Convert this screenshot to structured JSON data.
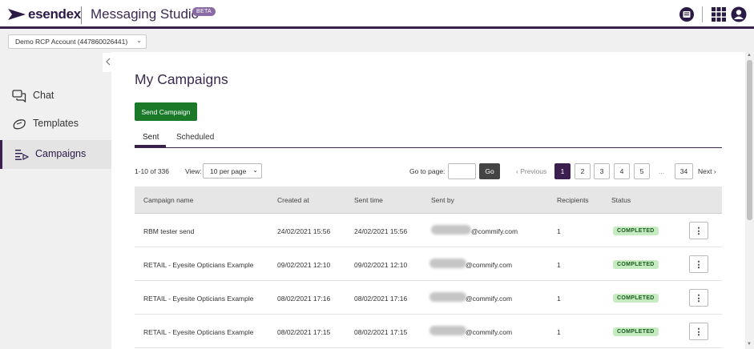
{
  "header": {
    "logo_text": "esendex",
    "app_title": "Messaging Studio",
    "beta_label": "BETA",
    "icons": [
      "contact-card-icon",
      "grid-apps-icon",
      "user-account-icon"
    ]
  },
  "account": {
    "selected": "Demo RCP Account (447860026441)"
  },
  "sidebar": {
    "items": [
      {
        "label": "Chat",
        "icon": "chat-bubbles-icon"
      },
      {
        "label": "Templates",
        "icon": "templates-icon"
      },
      {
        "label": "Campaigns",
        "icon": "campaigns-list-icon",
        "active": true
      }
    ]
  },
  "main": {
    "title": "My Campaigns",
    "send_button": "Send Campaign",
    "tabs": [
      {
        "label": "Sent",
        "active": true
      },
      {
        "label": "Scheduled"
      }
    ],
    "pagination": {
      "range_text": "1-10 of 336",
      "view_label": "View:",
      "view_selected": "10 per page",
      "goto_label": "Go to page:",
      "go_button": "Go",
      "previous": "Previous",
      "pages": [
        "1",
        "2",
        "3",
        "4",
        "5"
      ],
      "ellipsis": "...",
      "last_page": "34",
      "next": "Next",
      "current_page": "1"
    },
    "table": {
      "headers": [
        "Campaign name",
        "Created at",
        "Sent time",
        "Sent by",
        "Recipients",
        "Status"
      ],
      "rows": [
        {
          "name": "RBM tester send",
          "created": "24/02/2021 15:56",
          "sent": "24/02/2021 15:56",
          "sent_by": "@commify.com",
          "recipients": "1",
          "status": "COMPLETED"
        },
        {
          "name": "RETAIL - Eyesite Opticians Example",
          "created": "09/02/2021 12:10",
          "sent": "09/02/2021 12:10",
          "sent_by": "@commify.com",
          "recipients": "1",
          "status": "COMPLETED"
        },
        {
          "name": "RETAIL - Eyesite Opticians Example",
          "created": "08/02/2021 17:16",
          "sent": "08/02/2021 17:16",
          "sent_by": "@commify.com",
          "recipients": "1",
          "status": "COMPLETED"
        },
        {
          "name": "RETAIL - Eyesite Opticians Example",
          "created": "08/02/2021 17:15",
          "sent": "08/02/2021 17:15",
          "sent_by": "@commify.com",
          "recipients": "1",
          "status": "COMPLETED"
        }
      ],
      "row_action": "⋮"
    }
  },
  "colors": {
    "brand_purple": "#3b1f4f",
    "primary_green": "#1a7a2a",
    "status_green_bg": "#c6ebc0"
  }
}
